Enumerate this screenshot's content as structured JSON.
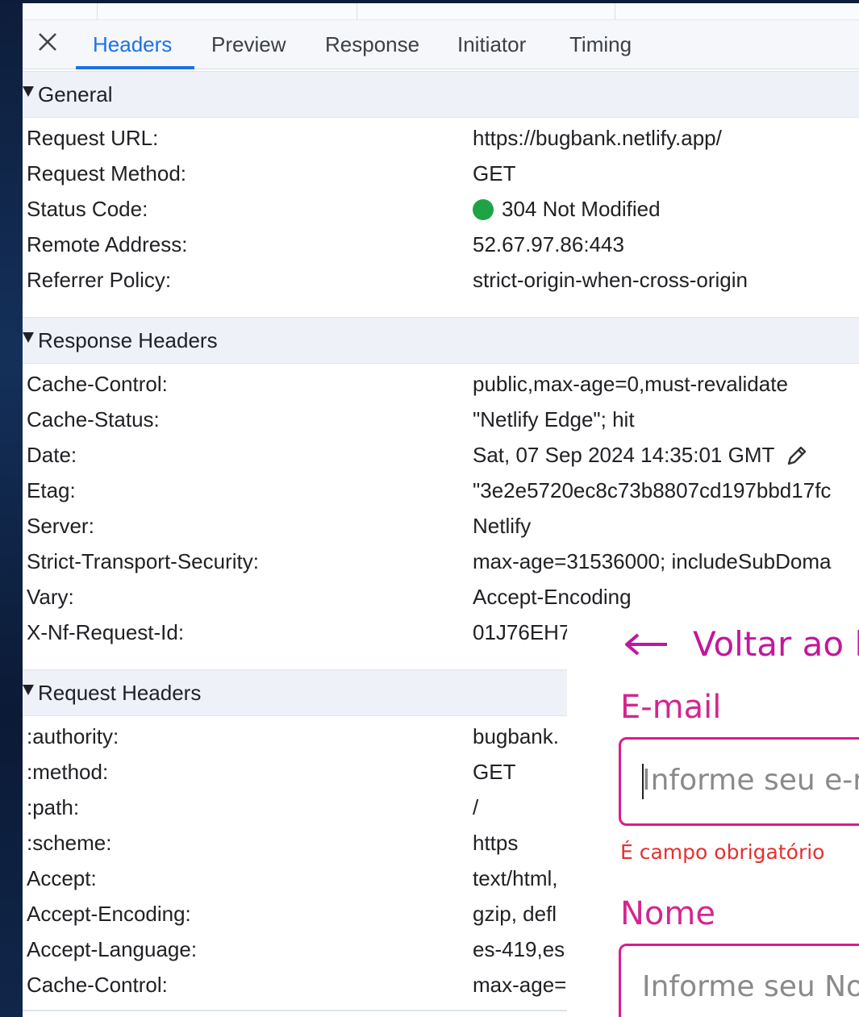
{
  "tabs": {
    "close_icon": "close-icon",
    "items": [
      "Headers",
      "Preview",
      "Response",
      "Initiator",
      "Timing"
    ],
    "active": "Headers"
  },
  "general": {
    "title": "General",
    "rows": [
      {
        "key": "Request URL:",
        "value": "https://bugbank.netlify.app/"
      },
      {
        "key": "Request Method:",
        "value": "GET"
      },
      {
        "key": "Status Code:",
        "value": "304 Not Modified",
        "status_color": "#1ea446"
      },
      {
        "key": "Remote Address:",
        "value": "52.67.97.86:443"
      },
      {
        "key": "Referrer Policy:",
        "value": "strict-origin-when-cross-origin"
      }
    ]
  },
  "response_headers": {
    "title": "Response Headers",
    "rows": [
      {
        "key": "Cache-Control:",
        "value": "public,max-age=0,must-revalidate"
      },
      {
        "key": "Cache-Status:",
        "value": "\"Netlify Edge\"; hit"
      },
      {
        "key": "Date:",
        "value": "Sat, 07 Sep 2024 14:35:01 GMT"
      },
      {
        "key": "Etag:",
        "value": "\"3e2e5720ec8c73b8807cd197bbd17fc"
      },
      {
        "key": "Server:",
        "value": "Netlify"
      },
      {
        "key": "Strict-Transport-Security:",
        "value": "max-age=31536000; includeSubDoma"
      },
      {
        "key": "Vary:",
        "value": "Accept-Encoding"
      },
      {
        "key": "X-Nf-Request-Id:",
        "value": "01J76EH7"
      }
    ]
  },
  "request_headers": {
    "title": "Request Headers",
    "rows": [
      {
        "key": ":authority:",
        "value": "bugbank."
      },
      {
        "key": ":method:",
        "value": "GET"
      },
      {
        "key": ":path:",
        "value": "/"
      },
      {
        "key": ":scheme:",
        "value": "https"
      },
      {
        "key": "Accept:",
        "value": "text/html,"
      },
      {
        "key": "Accept-Encoding:",
        "value": "gzip, defl"
      },
      {
        "key": "Accept-Language:",
        "value": "es-419,es"
      },
      {
        "key": "Cache-Control:",
        "value": "max-age="
      }
    ]
  },
  "form": {
    "back_label": "Voltar ao l",
    "email_label": "E-mail",
    "email_placeholder": "Informe seu e-m",
    "email_error": "É campo obrigatório",
    "name_label": "Nome",
    "name_placeholder": "Informe seu No",
    "accent_color": "#c2179d",
    "error_color": "#e4302f"
  }
}
